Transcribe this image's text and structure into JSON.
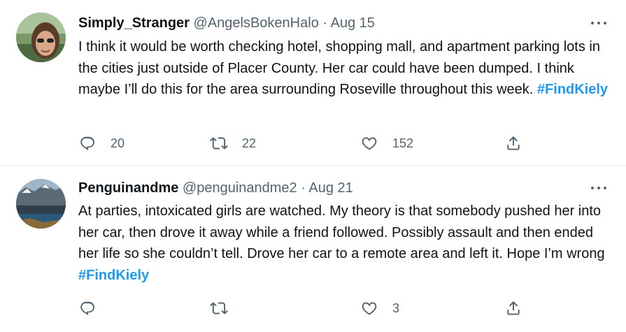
{
  "tweets": [
    {
      "name": "Simply_Stranger",
      "handle": "@AngelsBokenHalo",
      "separator": "·",
      "date": "Aug 15",
      "text": "I think it would be worth checking hotel, shopping mall, and apartment parking lots in the cities just outside of Placer County.  Her car could have been dumped.  I think maybe I’ll do this for the area surrounding Roseville throughout this week. ",
      "hashtag": "#FindKiely",
      "replies": "20",
      "retweets": "22",
      "likes": "152"
    },
    {
      "name": "Penguinandme",
      "handle": "@penguinandme2",
      "separator": "·",
      "date": "Aug 21",
      "text": "At parties, intoxicated girls are watched. My theory is that somebody pushed her into her car, then drove it away while a friend followed. Possibly assault and then ended her life so she couldn’t tell. Drove her car to a remote area and left it. Hope I’m wrong ",
      "hashtag": "#FindKiely",
      "replies": "",
      "retweets": "",
      "likes": "3"
    }
  ],
  "icons": {
    "reply": "reply-icon",
    "retweet": "retweet-icon",
    "like": "heart-icon",
    "share": "share-icon",
    "more": "more-dots-icon"
  },
  "colors": {
    "hashtag": "#1d9bf0",
    "secondary_text": "#536471",
    "divider": "#e6ecf0"
  }
}
